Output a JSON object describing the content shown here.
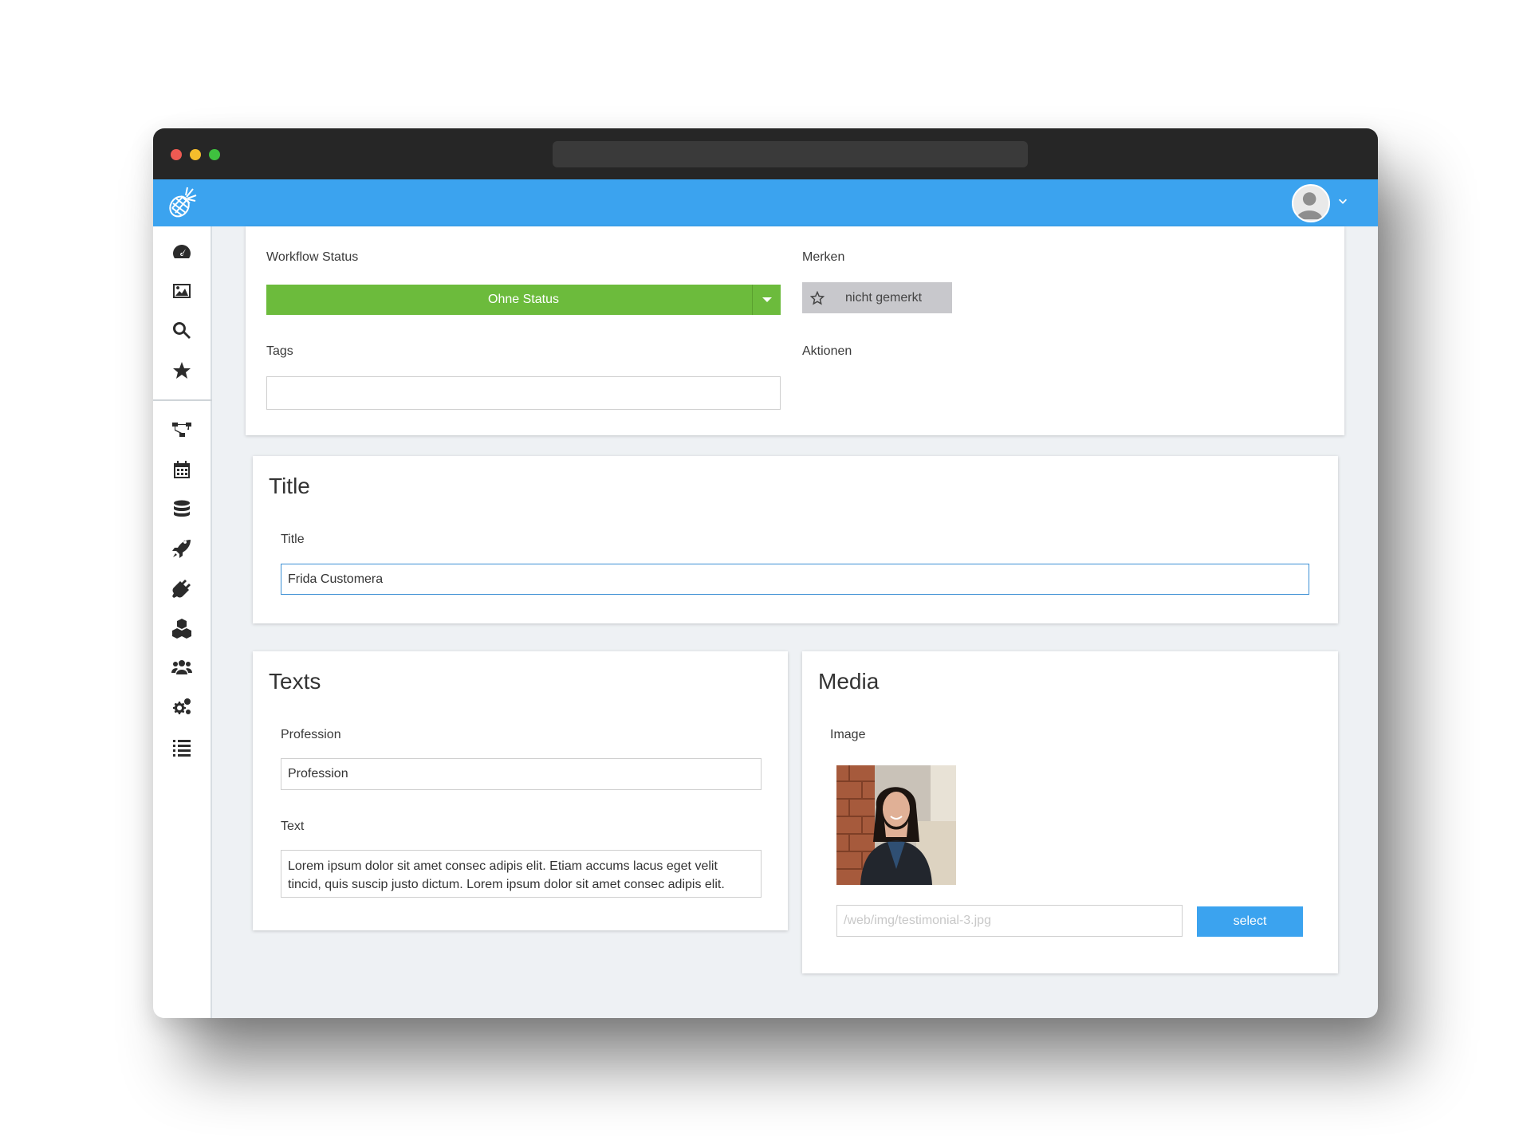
{
  "colors": {
    "appbar": "#3ba3ef",
    "status_green": "#6cbb3c",
    "select_button": "#3ba3ef",
    "merken_button": "#c8c8cc",
    "titlebar": "#262626"
  },
  "sidebar": {
    "icons": [
      "dashboard-icon",
      "image-icon",
      "search-icon",
      "star-icon",
      "sitemap-icon",
      "calendar-icon",
      "database-icon",
      "rocket-icon",
      "plug-icon",
      "cubes-icon",
      "users-icon",
      "cogs-icon",
      "list-icon"
    ]
  },
  "meta_panel": {
    "workflow_label": "Workflow Status",
    "workflow_value": "Ohne Status",
    "merken_label": "Merken",
    "merken_value": "nicht gemerkt",
    "tags_label": "Tags",
    "tags_value": "",
    "aktionen_label": "Aktionen"
  },
  "title_section": {
    "heading": "Title",
    "field_label": "Title",
    "field_value": "Frida Customera"
  },
  "texts_section": {
    "heading": "Texts",
    "profession_label": "Profession",
    "profession_value": "Profession",
    "text_label": "Text",
    "text_value": "Lorem ipsum dolor sit amet consec adipis elit. Etiam accums lacus eget velit tincid, quis suscip justo dictum. Lorem ipsum dolor sit amet consec adipis elit."
  },
  "media_section": {
    "heading": "Media",
    "image_label": "Image",
    "image_path": "/web/img/testimonial-3.jpg",
    "select_label": "select"
  }
}
